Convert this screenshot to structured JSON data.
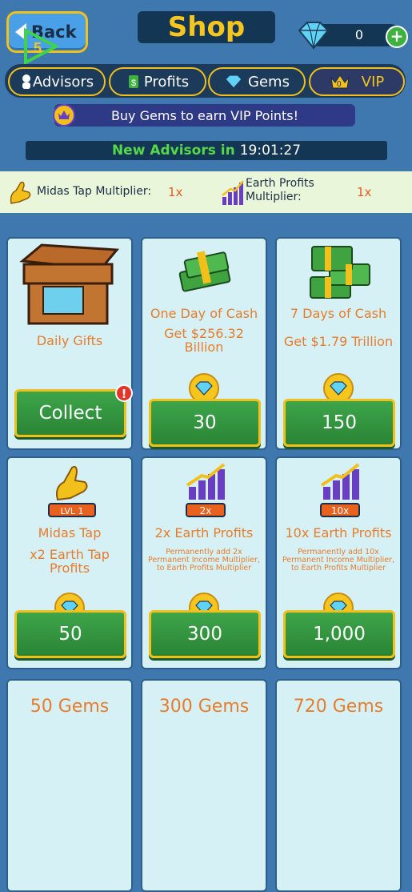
{
  "header": {
    "back_label": "Back",
    "title": "Shop",
    "gem_count": "0",
    "plus": "+",
    "overlay_digit": "5"
  },
  "tabs": [
    {
      "label": "Advisors"
    },
    {
      "label": "Profits"
    },
    {
      "label": "Gems"
    },
    {
      "label": "VIP",
      "badge": "0"
    }
  ],
  "vip_banner": {
    "text": "Buy Gems to earn VIP Points!"
  },
  "advisor_timer": {
    "label": "New Advisors in",
    "time": "19:01:27"
  },
  "multipliers": {
    "midas_label": "Midas Tap Multiplier:",
    "midas_value": "1x",
    "earth_label_1": "Earth Profits",
    "earth_label_2": "Multiplier:",
    "earth_value": "1x"
  },
  "cards": {
    "daily_gifts": {
      "title": "Daily Gifts",
      "button": "Collect",
      "alert": "!"
    },
    "one_day": {
      "title": "One Day of Cash",
      "sub_1": "Get $256.32",
      "sub_2": "Billion",
      "price": "30"
    },
    "seven_days": {
      "title": "7 Days of Cash",
      "sub_1": "Get $1.79 Trillion",
      "price": "150"
    },
    "midas_tap": {
      "badge": "LVL 1",
      "title": "Midas Tap",
      "sub_1": "x2 Earth Tap",
      "sub_2": "Profits",
      "price": "50"
    },
    "earth_2x": {
      "badge": "2x",
      "title": "2x Earth Profits",
      "desc_1": "Permanently add 2x",
      "desc_2": "Permanent Income Multiplier,",
      "desc_3": "to Earth Profits Multiplier",
      "price": "300"
    },
    "earth_10x": {
      "badge": "10x",
      "title": "10x Earth Profits",
      "desc_1": "Permanently add 10x",
      "desc_2": "Permanent Income Multiplier,",
      "desc_3": "to Earth Profits Multiplier",
      "price": "1,000"
    },
    "gems_50": {
      "title": "50 Gems"
    },
    "gems_300": {
      "title": "300 Gems"
    },
    "gems_720": {
      "title": "720 Gems"
    }
  },
  "colors": {
    "background": "#3e78ae",
    "accent_gold": "#f2c01b",
    "button_green": "#3da54a",
    "text_orange": "#e87c2c",
    "timer_green": "#55d84a"
  },
  "icons": [
    "back-arrow-icon",
    "diamond-icon",
    "plus-icon",
    "advisor-icon",
    "money-icon",
    "gem-icon",
    "crown-icon",
    "chest-icon",
    "cash-stack-icon",
    "golden-hand-icon",
    "growth-chart-icon",
    "alert-icon"
  ]
}
